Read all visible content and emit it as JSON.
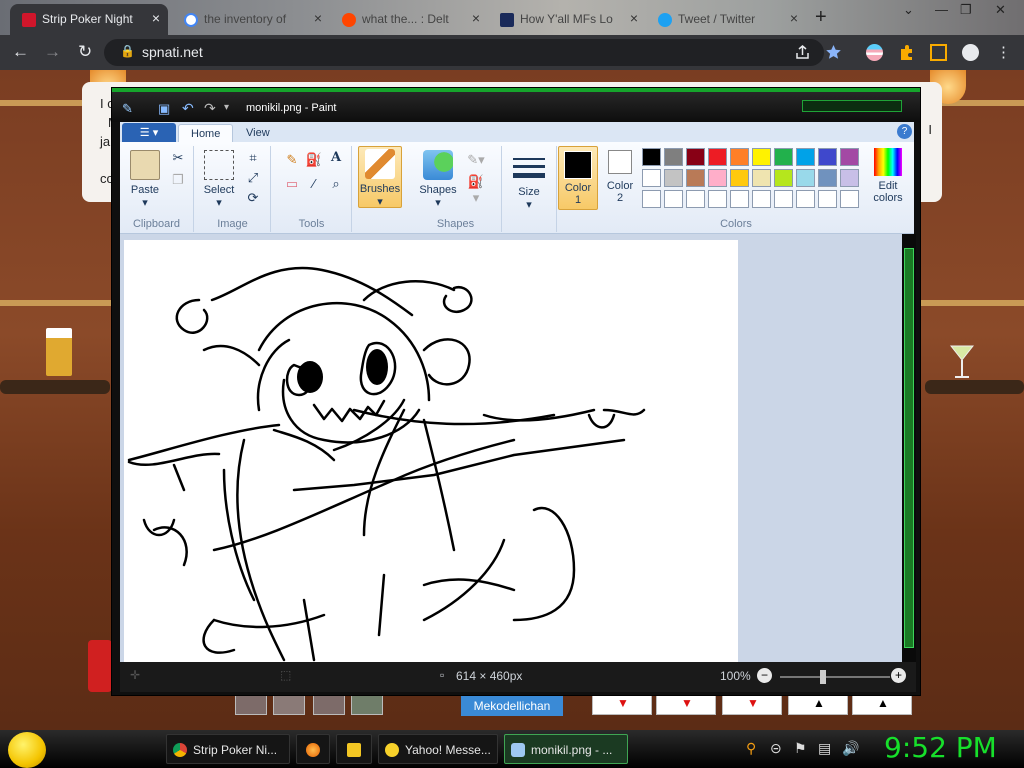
{
  "browser": {
    "tabs": [
      {
        "title": "Strip Poker Night",
        "active": true
      },
      {
        "title": "the inventory of",
        "active": false
      },
      {
        "title": "what the... : Delt",
        "active": false
      },
      {
        "title": "How Y'all MFs Lo",
        "active": false
      },
      {
        "title": "Tweet / Twitter",
        "active": false
      }
    ],
    "url": "spnati.net",
    "new_tab": "+",
    "tab_close": "×"
  },
  "game": {
    "dialog_lines": [
      "I c",
      "M",
      "ja",
      "co"
    ],
    "dialog_right": "I",
    "name_label": "Mekodellichan"
  },
  "paint": {
    "title": "monikil.png - Paint",
    "file_menu": "▾",
    "tabs": [
      "Home",
      "View"
    ],
    "help": "?",
    "clipboard": {
      "paste": "Paste",
      "label": "Clipboard"
    },
    "image": {
      "select": "Select",
      "label": "Image"
    },
    "tools": {
      "label": "Tools",
      "text_tool": "A"
    },
    "brushes": {
      "label": "Brushes"
    },
    "shapes": {
      "shapes": "Shapes",
      "label": "Shapes"
    },
    "size": {
      "label": "Size"
    },
    "colors": {
      "color1": "Color",
      "color1_num": "1",
      "color2": "Color",
      "color2_num": "2",
      "edit": "Edit",
      "edit2": "colors",
      "label": "Colors",
      "row1": [
        "#000000",
        "#7f7f7f",
        "#880015",
        "#ed1c24",
        "#ff7f27",
        "#fff200",
        "#22b14c",
        "#00a2e8",
        "#3f48cc",
        "#a349a4"
      ],
      "row2": [
        "#ffffff",
        "#c3c3c3",
        "#b97a57",
        "#ffaec9",
        "#ffc90e",
        "#efe4b0",
        "#b5e61d",
        "#99d9ea",
        "#7092be",
        "#c8bfe7"
      ]
    },
    "status": {
      "dimensions": "614 × 460px",
      "zoom": "100%",
      "zoom_out": "−",
      "zoom_in": "+"
    }
  },
  "taskbar": {
    "items": [
      {
        "label": "Strip Poker Ni..."
      },
      {
        "label": "Yahoo! Messe..."
      },
      {
        "label": "monikil.png - ..."
      }
    ],
    "clock": "9:52 PM"
  }
}
